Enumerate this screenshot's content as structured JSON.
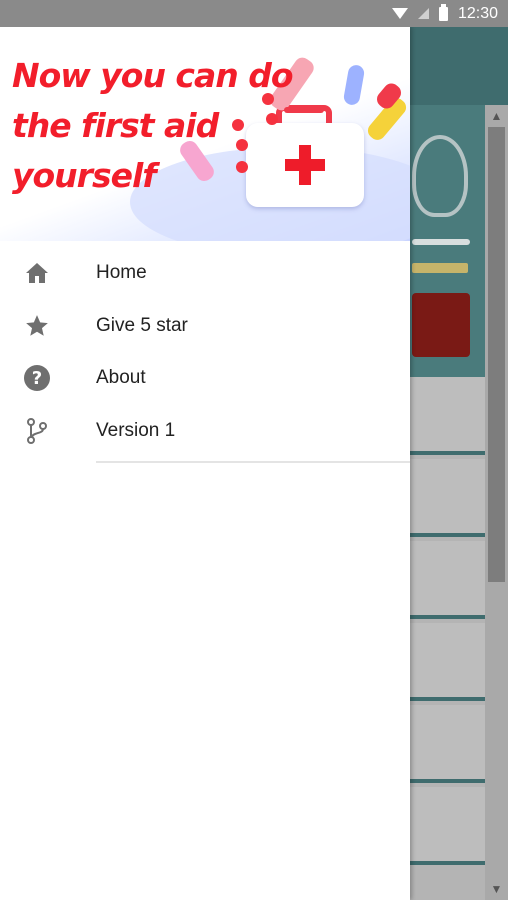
{
  "status_bar": {
    "time": "12:30"
  },
  "drawer": {
    "header": {
      "headline_lines": [
        "Now you can do",
        "the first aid",
        "yourself"
      ]
    },
    "menu": [
      {
        "icon": "home-icon",
        "label": "Home"
      },
      {
        "icon": "star-icon",
        "label": "Give 5 star"
      },
      {
        "icon": "help-icon",
        "label": "About"
      },
      {
        "icon": "version-branch-icon",
        "label": "Version 1"
      }
    ]
  },
  "colors": {
    "headline": "#f21e2b",
    "toolbar_teal": "#3f6c6e",
    "icon_gray": "#6f6f6f"
  }
}
